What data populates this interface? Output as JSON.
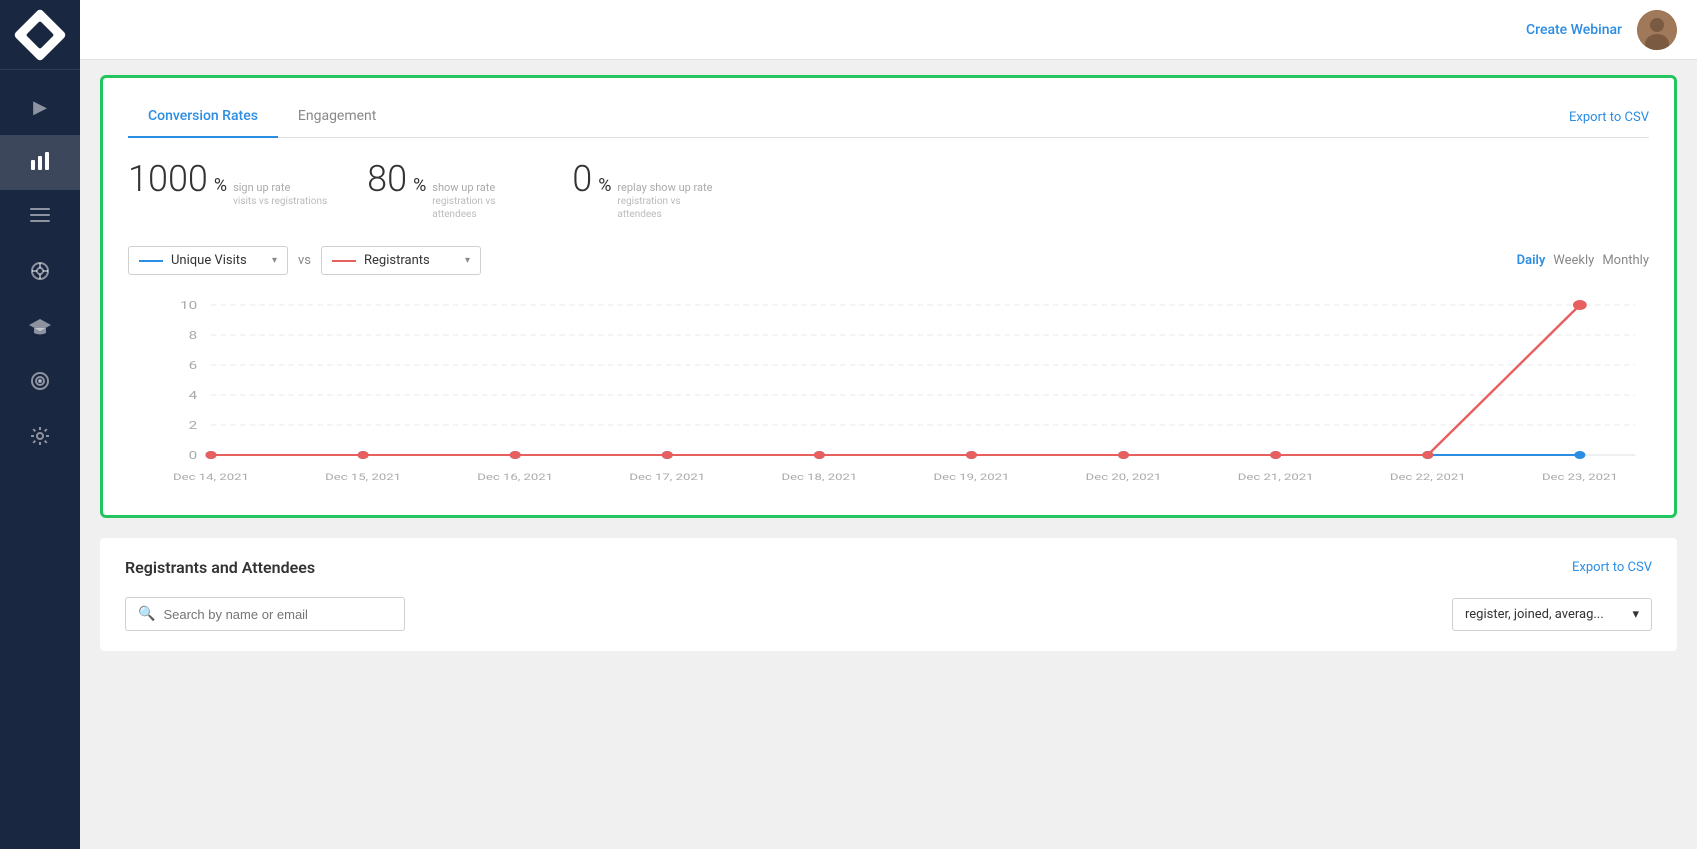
{
  "sidebar": {
    "logo_alt": "Logo",
    "items": [
      {
        "id": "play",
        "icon": "▶",
        "active": false,
        "label": "Play"
      },
      {
        "id": "analytics",
        "icon": "📊",
        "active": true,
        "label": "Analytics"
      },
      {
        "id": "list",
        "icon": "☰",
        "active": false,
        "label": "List"
      },
      {
        "id": "integration",
        "icon": "⚙",
        "active": false,
        "label": "Integration"
      },
      {
        "id": "education",
        "icon": "🎓",
        "active": false,
        "label": "Education"
      },
      {
        "id": "target",
        "icon": "◎",
        "active": false,
        "label": "Target"
      },
      {
        "id": "settings",
        "icon": "⚙",
        "active": false,
        "label": "Settings"
      }
    ]
  },
  "topbar": {
    "create_webinar_label": "Create Webinar",
    "avatar_alt": "User Avatar"
  },
  "conversion_rates_card": {
    "tabs": [
      {
        "id": "conversion",
        "label": "Conversion Rates",
        "active": true
      },
      {
        "id": "engagement",
        "label": "Engagement",
        "active": false
      }
    ],
    "export_label": "Export to CSV",
    "stats": [
      {
        "value": "1000",
        "percent": "%",
        "label_title": "sign up rate",
        "label_sub": "visits vs registrations"
      },
      {
        "value": "80",
        "percent": "%",
        "label_title": "show up rate",
        "label_sub": "registration vs attendees"
      },
      {
        "value": "0",
        "percent": "%",
        "label_title": "replay show up rate",
        "label_sub": "registration vs attendees"
      }
    ],
    "chart": {
      "left_select": {
        "line_color": "#2b8de3",
        "label": "Unique Visits"
      },
      "vs_label": "vs",
      "right_select": {
        "line_color": "#e85f5f",
        "label": "Registrants"
      },
      "time_buttons": [
        {
          "label": "Daily",
          "active": true
        },
        {
          "label": "Weekly",
          "active": false
        },
        {
          "label": "Monthly",
          "active": false
        }
      ],
      "y_labels": [
        "10",
        "8",
        "6",
        "4",
        "2",
        "0"
      ],
      "x_labels": [
        "Dec 14, 2021",
        "Dec 15, 2021",
        "Dec 16, 2021",
        "Dec 17, 2021",
        "Dec 18, 2021",
        "Dec 19, 2021",
        "Dec 20, 2021",
        "Dec 21, 2021",
        "Dec 22, 2021",
        "Dec 23, 2021"
      ]
    }
  },
  "registrants_card": {
    "title": "Registrants and Attendees",
    "export_label": "Export to CSV",
    "search_placeholder": "Search by name or email",
    "filter_value": "register, joined, averag..."
  }
}
